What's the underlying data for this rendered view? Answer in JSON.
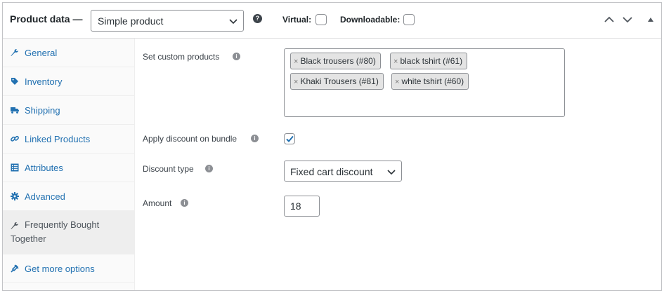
{
  "header": {
    "title": "Product data —",
    "product_type": "Simple product",
    "help_mark": "?",
    "virtual_label": "Virtual:",
    "virtual_checked": false,
    "downloadable_label": "Downloadable:",
    "downloadable_checked": false,
    "icons": [
      "chevron-up-icon",
      "chevron-down-icon",
      "triangle-up-icon"
    ]
  },
  "sidebar": {
    "items": [
      {
        "label": "General",
        "icon": "wrench-icon",
        "active": false
      },
      {
        "label": "Inventory",
        "icon": "tag-icon",
        "active": false
      },
      {
        "label": "Shipping",
        "icon": "truck-icon",
        "active": false
      },
      {
        "label": "Linked Products",
        "icon": "link-icon",
        "active": false
      },
      {
        "label": "Attributes",
        "icon": "list-icon",
        "active": false
      },
      {
        "label": "Advanced",
        "icon": "gear-icon",
        "active": false
      },
      {
        "label": "Frequently Bought Together",
        "icon": "wrench-icon",
        "active": true
      },
      {
        "label": "Get more options",
        "icon": "plugin-icon",
        "active": false
      }
    ]
  },
  "form": {
    "custom_products_label": "Set custom products",
    "custom_products": [
      "Black trousers (#80)",
      "black tshirt (#61)",
      "Khaki Trousers (#81)",
      "white tshirt (#60)"
    ],
    "tag_remove": "×",
    "info_mark": "i",
    "apply_discount_label": "Apply discount on bundle",
    "apply_discount_checked": true,
    "discount_type_label": "Discount type",
    "discount_type_value": "Fixed cart discount",
    "amount_label": "Amount",
    "amount_value": "18"
  },
  "colors": {
    "link": "#2271b1",
    "text": "#1d2327",
    "active_bg": "#eeeeee",
    "sidebar_bg": "#fafafa",
    "tag_bg": "#e4e4e4"
  }
}
